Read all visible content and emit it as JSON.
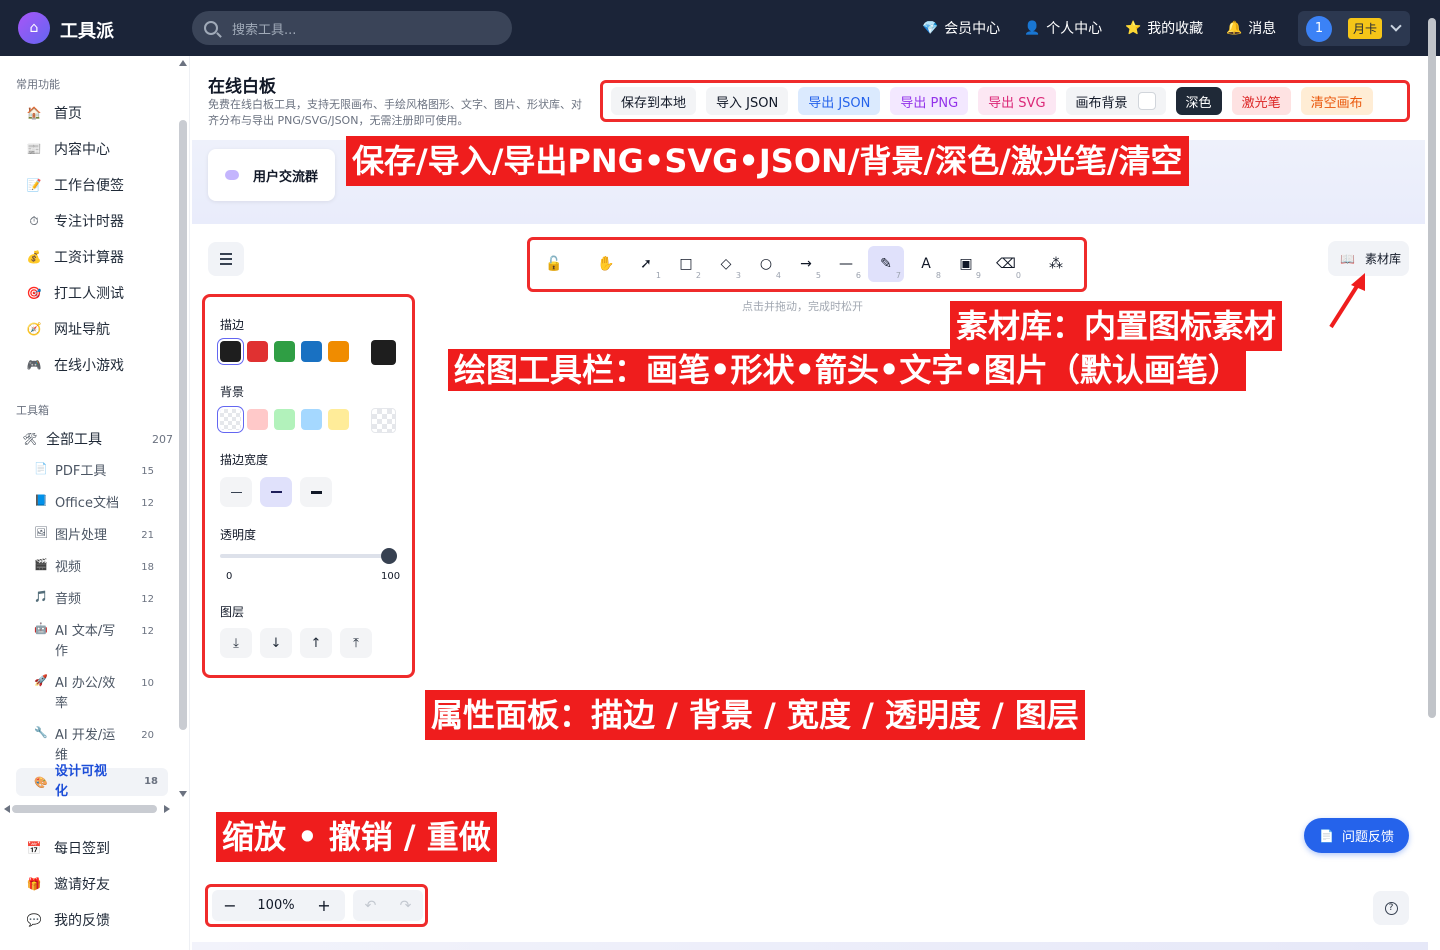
{
  "topbar": {
    "brand": "工具派",
    "search_placeholder": "搜索工具...",
    "nav": [
      {
        "icon": "diamond-icon",
        "glyph": "💎",
        "label": "会员中心"
      },
      {
        "icon": "person-icon",
        "glyph": "👤",
        "label": "个人中心"
      },
      {
        "icon": "star-icon",
        "glyph": "⭐",
        "label": "我的收藏"
      },
      {
        "icon": "bell-icon",
        "glyph": "🔔",
        "label": "消息"
      }
    ],
    "user_badge_number": "1",
    "membership_badge": "月卡"
  },
  "sidebar": {
    "common_title": "常用功能",
    "common_items": [
      {
        "icon": "home-icon",
        "glyph": "🏠",
        "label": "首页"
      },
      {
        "icon": "content-icon",
        "glyph": "📰",
        "label": "内容中心"
      },
      {
        "icon": "note-icon",
        "glyph": "📝",
        "label": "工作台便签"
      },
      {
        "icon": "timer-icon",
        "glyph": "⏱",
        "label": "专注计时器"
      },
      {
        "icon": "money-icon",
        "glyph": "💰",
        "label": "工资计算器"
      },
      {
        "icon": "target-icon",
        "glyph": "🎯",
        "label": "打工人测试"
      },
      {
        "icon": "globe-icon",
        "glyph": "🧭",
        "label": "网址导航"
      },
      {
        "icon": "gamepad-icon",
        "glyph": "🎮",
        "label": "在线小游戏"
      }
    ],
    "toolbox_title": "工具箱",
    "all_tools": {
      "icon": "tools-icon",
      "glyph": "🛠",
      "label": "全部工具",
      "count": "207"
    },
    "categories": [
      {
        "icon": "pdf-icon",
        "glyph": "📄",
        "label": "PDF工具",
        "count": "15"
      },
      {
        "icon": "office-icon",
        "glyph": "📘",
        "label": "Office文档",
        "count": "12"
      },
      {
        "icon": "image-icon",
        "glyph": "🖼",
        "label": "图片处理",
        "count": "21"
      },
      {
        "icon": "video-icon",
        "glyph": "🎬",
        "label": "视频",
        "count": "18"
      },
      {
        "icon": "music-icon",
        "glyph": "🎵",
        "label": "音频",
        "count": "12"
      },
      {
        "icon": "robot-icon",
        "glyph": "🤖",
        "label": "AI 文本/写作",
        "count": "12"
      },
      {
        "icon": "rocket-icon",
        "glyph": "🚀",
        "label": "AI 办公/效率",
        "count": "10"
      },
      {
        "icon": "wrench-icon",
        "glyph": "🔧",
        "label": "AI 开发/运维",
        "count": "20"
      },
      {
        "icon": "palette-icon",
        "glyph": "🎨",
        "label": "设计可视化",
        "count": "18"
      }
    ],
    "bottom_items": [
      {
        "icon": "calendar-icon",
        "glyph": "📅",
        "label": "每日签到"
      },
      {
        "icon": "gift-icon",
        "glyph": "🎁",
        "label": "邀请好友"
      },
      {
        "icon": "feedback-icon",
        "glyph": "💬",
        "label": "我的反馈"
      }
    ]
  },
  "page": {
    "title": "在线白板",
    "description": "免费在线白板工具，支持无限画布、手绘风格图形、文字、图片、形状库、对齐分布与导出 PNG/SVG/JSON，无需注册即可使用。",
    "actions": {
      "save_local": "保存到本地",
      "import_json": "导入 JSON",
      "export_json": "导出 JSON",
      "export_png": "导出 PNG",
      "export_svg": "导出 SVG",
      "canvas_bg": "画布背景",
      "dark": "深色",
      "laser": "激光笔",
      "clear": "清空画布"
    },
    "user_group": "用户交流群",
    "hint": "点击并拖动，完成时松开",
    "library": "素材库",
    "feedback_button": "问题反馈",
    "zoom": "100%"
  },
  "toolbar_tools": [
    {
      "name": "lock-icon",
      "glyph": "🔓",
      "key": ""
    },
    {
      "name": "hand-icon",
      "glyph": "✋",
      "key": ""
    },
    {
      "name": "select-icon",
      "glyph": "➚",
      "key": "1"
    },
    {
      "name": "rectangle-icon",
      "glyph": "□",
      "key": "2"
    },
    {
      "name": "diamond-shape-icon",
      "glyph": "◇",
      "key": "3"
    },
    {
      "name": "ellipse-icon",
      "glyph": "○",
      "key": "4"
    },
    {
      "name": "arrow-icon",
      "glyph": "→",
      "key": "5"
    },
    {
      "name": "line-icon",
      "glyph": "—",
      "key": "6"
    },
    {
      "name": "pen-icon",
      "glyph": "✎",
      "key": "7",
      "selected": true
    },
    {
      "name": "text-icon",
      "glyph": "A",
      "key": "8"
    },
    {
      "name": "image-insert-icon",
      "glyph": "▣",
      "key": "9"
    },
    {
      "name": "eraser-icon",
      "glyph": "⌫",
      "key": "0"
    },
    {
      "name": "shapes-more-icon",
      "glyph": "⁂",
      "key": ""
    }
  ],
  "properties": {
    "stroke_label": "描边",
    "stroke_colors": [
      "#1e1e1e",
      "#e03131",
      "#2f9e44",
      "#1971c2",
      "#f08c00"
    ],
    "stroke_current": "#1e1e1e",
    "background_label": "背景",
    "background_colors": [
      "transparent",
      "#ffc9c9",
      "#b2f2bb",
      "#a5d8ff",
      "#ffec99"
    ],
    "stroke_width_label": "描边宽度",
    "opacity_label": "透明度",
    "opacity_min": "0",
    "opacity_max": "100",
    "opacity_value": 100,
    "layers_label": "图层"
  },
  "annotations": {
    "a1": "保存/导入/导出PNG•SVG•JSON/背景/深色/激光笔/清空",
    "a2": "素材库：内置图标素材",
    "a3": "绘图工具栏：画笔•形状•箭头•文字•图片（默认画笔）",
    "a4": "属性面板：描边 / 背景 / 宽度 / 透明度 / 图层",
    "a5": "缩放 • 撤销 / 重做"
  },
  "colors": {
    "accent": "#2563eb",
    "topbar": "#1b2438",
    "annotation": "#ef1d1d",
    "selected_tool": "#e0e1fb"
  }
}
